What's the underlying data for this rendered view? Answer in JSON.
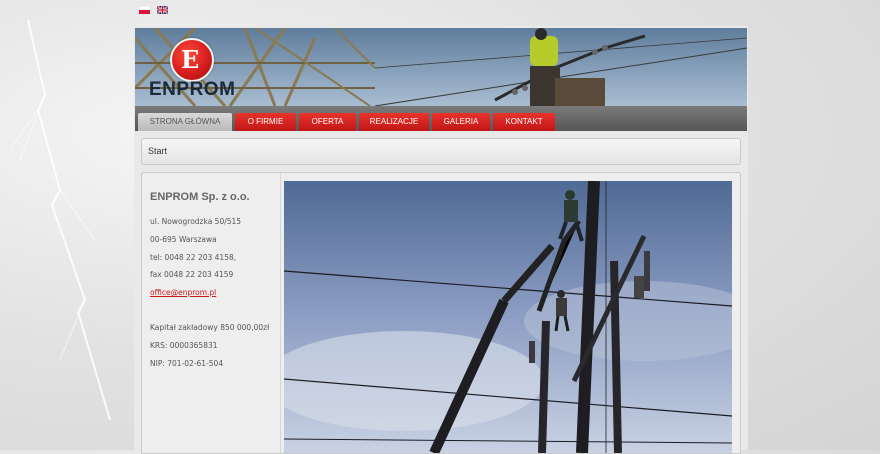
{
  "languages": [
    {
      "code": "pl",
      "icon": "poland-flag-icon"
    },
    {
      "code": "en",
      "icon": "uk-flag-icon"
    }
  ],
  "brand": {
    "name": "ENPROM",
    "logo_icon": "enprom-logo-icon",
    "accent_color": "#d61e1e"
  },
  "nav": {
    "items": [
      {
        "label": "STRONA GŁÓWNA",
        "active": true
      },
      {
        "label": "O FIRMIE"
      },
      {
        "label": "OFERTA"
      },
      {
        "label": "REALIZACJE"
      },
      {
        "label": "GALERIA"
      },
      {
        "label": "KONTAKT"
      }
    ]
  },
  "breadcrumb": {
    "current": "Start"
  },
  "company": {
    "name": "ENPROM Sp. z o.o.",
    "address": "ul. Nowogrodzka 50/515",
    "city": "00-695 Warszawa",
    "phone": "tel: 0048 22 203 4158,",
    "fax": "fax 0048 22 203 4159",
    "email": "office@enprom.pl",
    "capital": "Kapitał zakładowy 850 000,00zł",
    "krs": "KRS: 0000365831",
    "nip": "NIP: 701-02-61-504"
  }
}
